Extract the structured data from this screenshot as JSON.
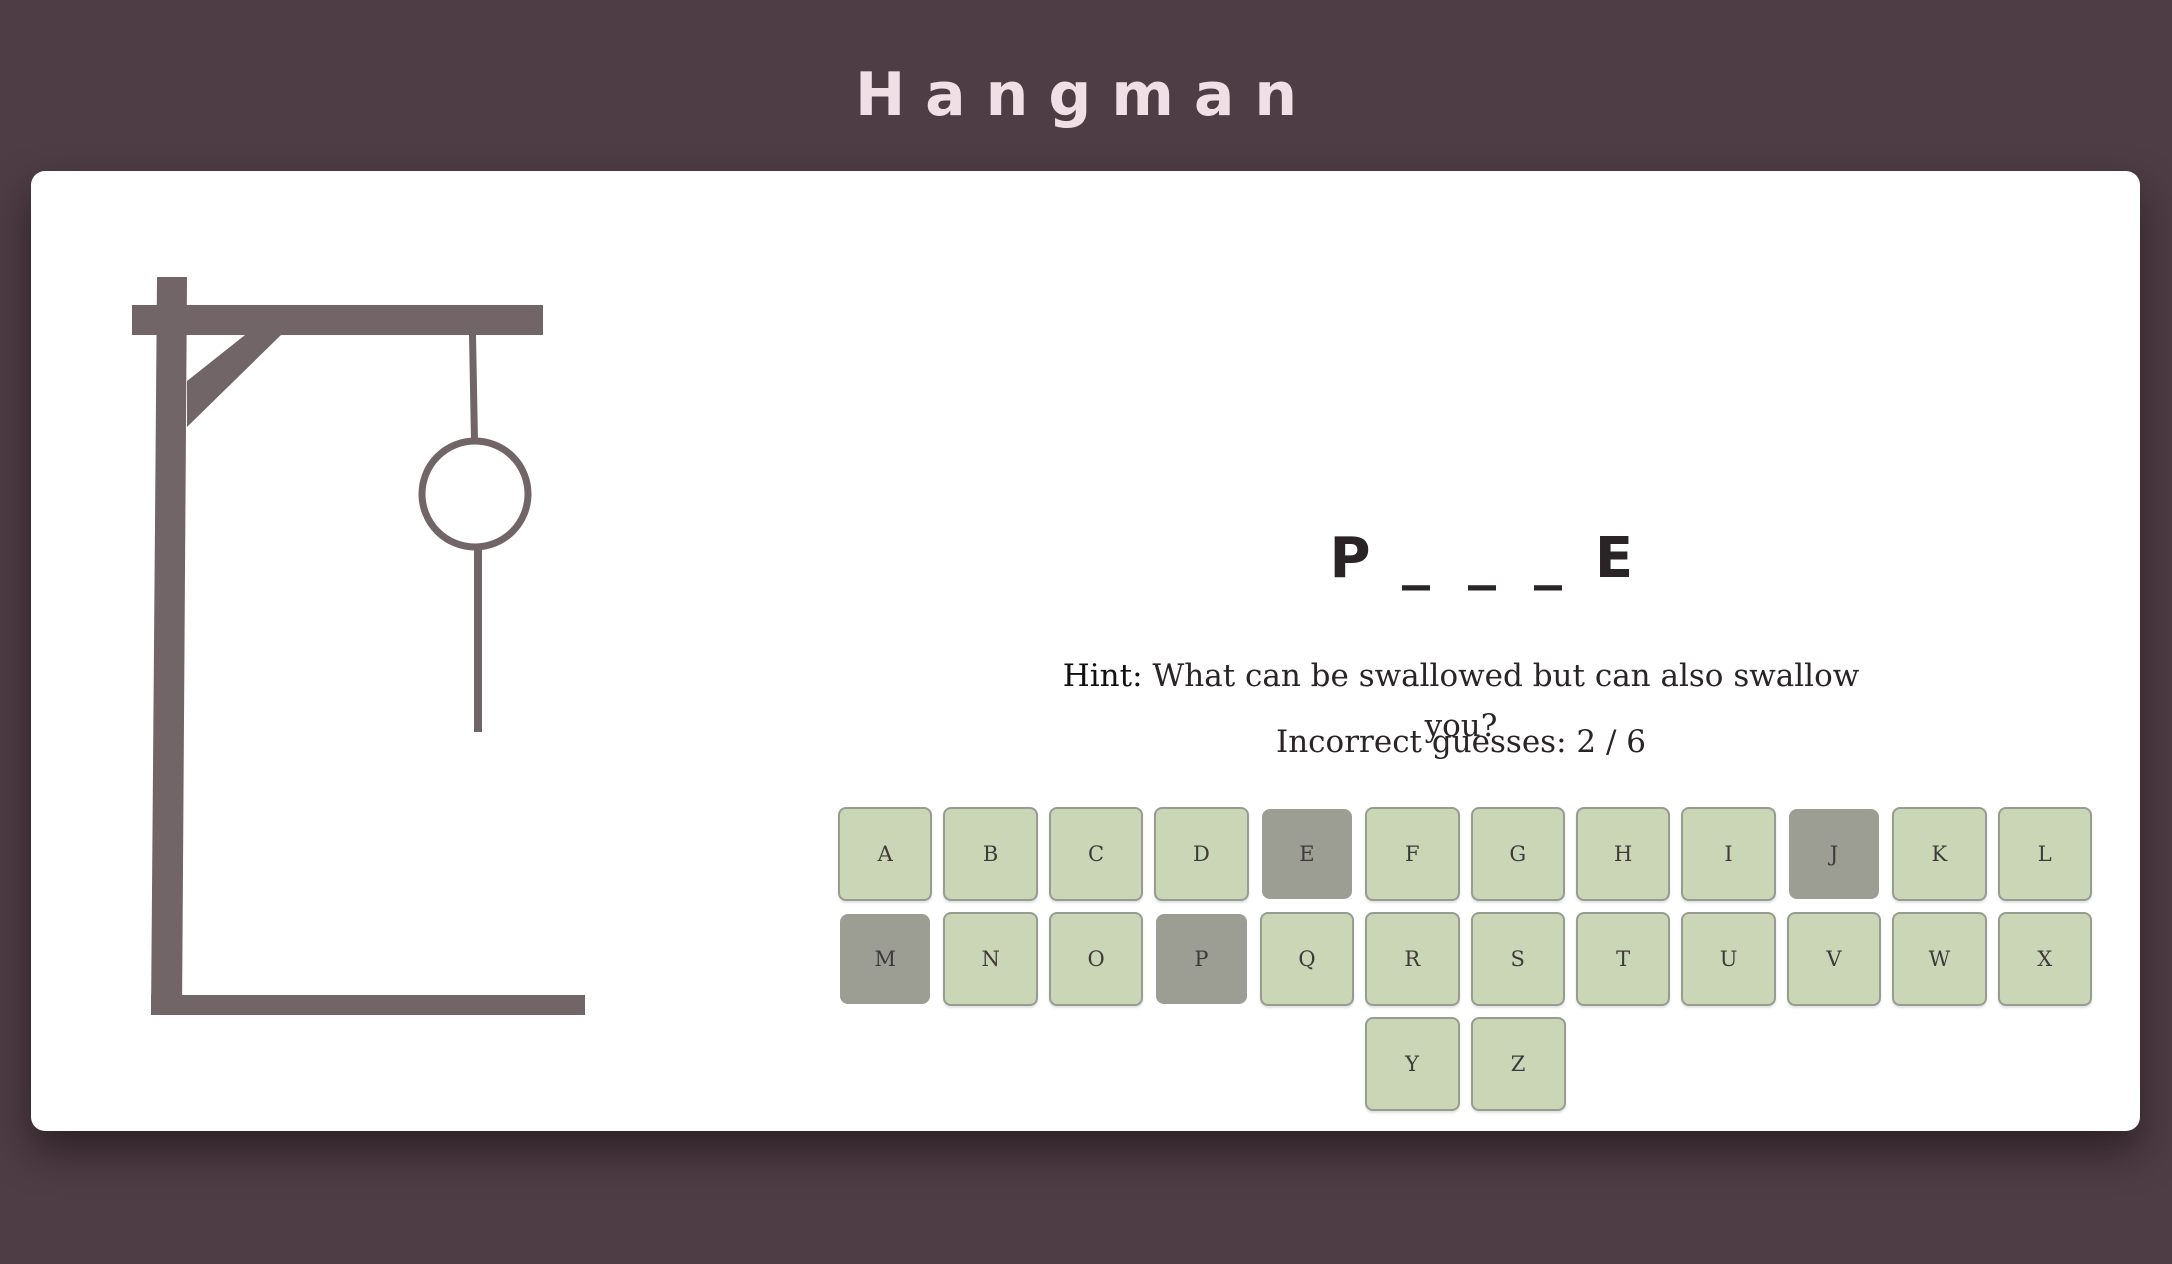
{
  "app": {
    "title": "Hangman"
  },
  "game": {
    "word_display": [
      "P",
      "_",
      "_",
      "_",
      "E"
    ],
    "hint_label": "Hint:",
    "hint_text": "What can be swallowed but can also swallow you?",
    "incorrect_label": "Incorrect guesses:",
    "incorrect_count": "2 / 6",
    "wrong_guesses": 2,
    "max_guesses": 6
  },
  "keyboard": {
    "rows": [
      [
        {
          "letter": "A",
          "used": false
        },
        {
          "letter": "B",
          "used": false
        },
        {
          "letter": "C",
          "used": false
        },
        {
          "letter": "D",
          "used": false
        },
        {
          "letter": "E",
          "used": true
        },
        {
          "letter": "F",
          "used": false
        },
        {
          "letter": "G",
          "used": false
        },
        {
          "letter": "H",
          "used": false
        },
        {
          "letter": "I",
          "used": false
        },
        {
          "letter": "J",
          "used": true
        },
        {
          "letter": "K",
          "used": false
        },
        {
          "letter": "L",
          "used": false
        }
      ],
      [
        {
          "letter": "M",
          "used": true
        },
        {
          "letter": "N",
          "used": false
        },
        {
          "letter": "O",
          "used": false
        },
        {
          "letter": "P",
          "used": true
        },
        {
          "letter": "Q",
          "used": false
        },
        {
          "letter": "R",
          "used": false
        },
        {
          "letter": "S",
          "used": false
        },
        {
          "letter": "T",
          "used": false
        },
        {
          "letter": "U",
          "used": false
        },
        {
          "letter": "V",
          "used": false
        },
        {
          "letter": "W",
          "used": false
        },
        {
          "letter": "X",
          "used": false
        }
      ],
      [
        {
          "letter": "Y",
          "used": false
        },
        {
          "letter": "Z",
          "used": false
        }
      ]
    ]
  },
  "colors": {
    "background": "#4e3d44",
    "gallows": "#716567",
    "key": "#cbd6b7",
    "key_used": "#9c9e93",
    "title": "#f0dfe4"
  }
}
